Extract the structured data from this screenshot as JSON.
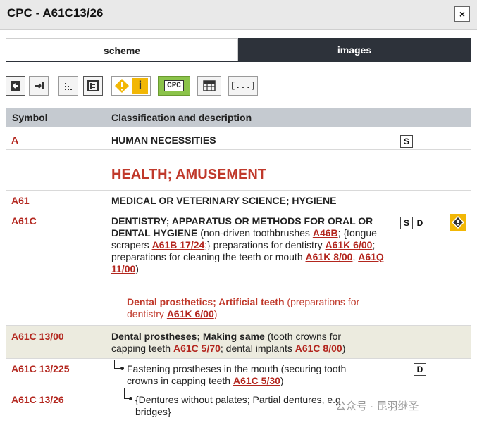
{
  "window": {
    "title": "CPC - A61C13/26",
    "close_label": "×"
  },
  "tabs": [
    {
      "label": "scheme",
      "active": true
    },
    {
      "label": "images",
      "active": false
    }
  ],
  "toolbar": {
    "cpc_label": "CPC",
    "info_label": "i",
    "bracket_label": "[...]"
  },
  "table": {
    "col_symbol": "Symbol",
    "col_desc": "Classification and description"
  },
  "rows": {
    "a": {
      "symbol": "A",
      "title": "HUMAN NECESSITIES"
    },
    "health": {
      "heading": "HEALTH; AMUSEMENT"
    },
    "a61": {
      "symbol": "A61",
      "title": "MEDICAL OR VETERINARY SCIENCE; HYGIENE"
    },
    "a61c": {
      "symbol": "A61C",
      "title": "DENTISTRY; APPARATUS OR METHODS FOR ORAL OR DENTAL HYGIENE",
      "t1": " (non-driven toothbrushes ",
      "r1": "A46B",
      "t2": "; {tongue scrapers ",
      "r2": "A61B 17/24",
      "t3": ";} preparations for dentistry ",
      "r3": "A61K 6/00",
      "t4": "; preparations for cleaning the teeth or mouth ",
      "r4": "A61K 8/00",
      "t5": ", ",
      "r5": "A61Q 11/00",
      "t6": ")"
    },
    "dental_prosthetics": {
      "title": "Dental prosthetics; Artificial teeth",
      "t1": " (preparations for dentistry ",
      "r1": "A61K 6/00",
      "t2": ")"
    },
    "a61c1300": {
      "symbol": "A61C 13/00",
      "title": "Dental prostheses; Making same",
      "t1": " (tooth crowns for capping teeth ",
      "r1": "A61C 5/70",
      "t2": "; dental implants ",
      "r2": "A61C 8/00",
      "t3": ")"
    },
    "a61c13225": {
      "symbol": "A61C 13/225",
      "t1": "Fastening prostheses in the mouth (securing tooth crowns in capping teeth ",
      "r1": "A61C 5/30",
      "t2": ")"
    },
    "a61c1326": {
      "symbol": "A61C 13/26",
      "t1": "{Dentures without palates; Partial dentures, e.g. bridges}"
    }
  },
  "badges": {
    "s": "S",
    "d": "D"
  },
  "colors": {
    "ref_red": "#b3261e",
    "tab_dark": "#2d323a",
    "header_gray": "#c5cad0",
    "warn_yellow": "#f2b705",
    "cpc_green": "#8bc34a"
  },
  "watermark": "公众号 · 昆羽继圣"
}
